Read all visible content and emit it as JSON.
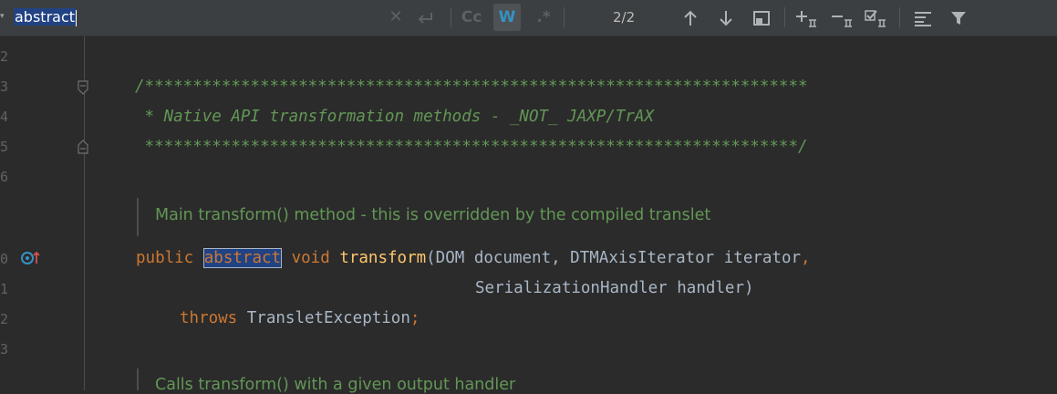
{
  "search": {
    "query": "abstract",
    "match_count": "2/2",
    "options": {
      "match_case_label": "Cc",
      "words_label": "W",
      "regex_label": ".*"
    }
  },
  "gutter": {
    "line_numbers": [
      "2",
      "3",
      "4",
      "5",
      "6",
      "0",
      "1",
      "2",
      "3"
    ]
  },
  "code": {
    "comment_line1": "/*********************************************************************",
    "comment_line2": " * Native API transformation methods - _NOT_ JAXP/TrAX",
    "comment_line3": " ********************************************************************/",
    "doc1": "Main transform() method - this is overridden by the compiled translet",
    "sig_public": "public",
    "sig_abstract": "abstract",
    "sig_void": "void",
    "sig_name": "transform",
    "sig_params1": "(DOM document, DTMAxisIterator iterator",
    "sig_comma": ",",
    "sig_params2": "SerializationHandler handler)",
    "sig_throws": "throws",
    "sig_exception": "TransletException",
    "sig_semicolon": ";",
    "doc2": "Calls transform() with a given output handler"
  },
  "colors": {
    "background": "#2b2b2b",
    "toolbar": "#3c3f41",
    "keyword": "#cc7832",
    "function": "#ffc66d",
    "comment": "#629755",
    "text": "#a9b7c6",
    "selection": "#214283"
  },
  "icons": {
    "clear": "close-icon",
    "newline": "newline-icon",
    "prev": "arrow-up-icon",
    "next": "arrow-down-icon",
    "open_window": "window-icon",
    "add_occurrence": "add-selection-icon",
    "remove_occurrence": "remove-selection-icon",
    "select_all": "select-all-icon",
    "multiline": "multiline-icon",
    "filter": "filter-icon"
  }
}
